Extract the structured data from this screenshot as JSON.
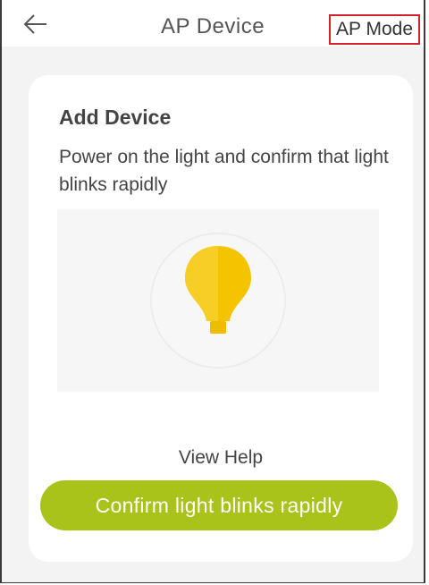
{
  "header": {
    "title": "AP Device",
    "back_icon": "arrow-left-icon",
    "mode_label": "AP Mode",
    "mode_highlight_color": "#d2232a"
  },
  "card": {
    "title": "Add Device",
    "description": "Power on the light and confirm that light blinks rapidly",
    "illustration_icon": "light-bulb-icon",
    "bulb_color": "#f5c400",
    "view_help_label": "View Help",
    "confirm_label": "Confirm light blinks rapidly",
    "confirm_color": "#a9c31a"
  }
}
